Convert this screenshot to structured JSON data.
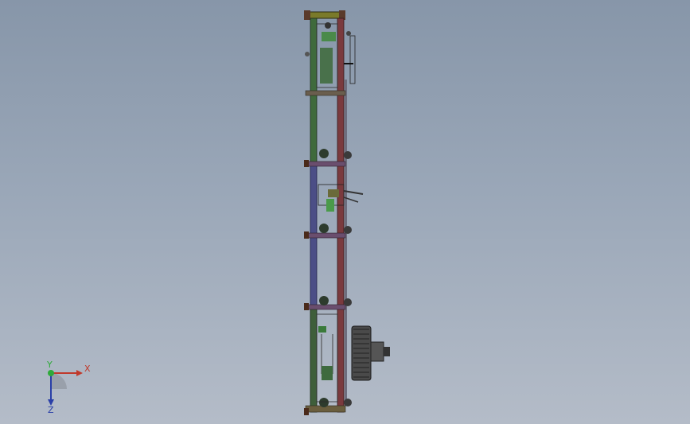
{
  "viewport": {
    "background_top": "#8796a9",
    "background_bottom": "#b4bcc8"
  },
  "model": {
    "frame_colors": {
      "left_upper": "#3f6a3c",
      "left_mid": "#4b4e86",
      "left_lower": "#3e5e3a",
      "right_rail": "#7a3a3e",
      "top_cap": "#7a7a2a",
      "crossbar": "#6a4e6e"
    }
  },
  "triad": {
    "x_label": "X",
    "y_label": "Y",
    "z_label": "Z",
    "x_color": "#c0392b",
    "y_color": "#2eaa3a",
    "z_color": "#2a3fa8"
  }
}
